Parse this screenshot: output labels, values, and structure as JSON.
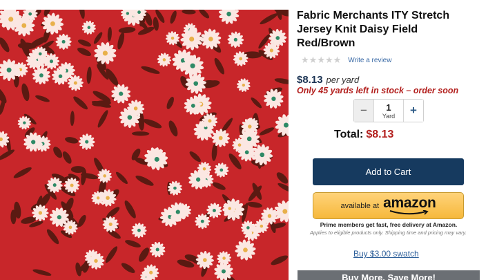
{
  "product": {
    "title_line1": "Fabric Merchants ITY Stretch",
    "title_line2": "Jersey Knit Daisy Field",
    "title_line3": "Red/Brown",
    "rating": 0,
    "rating_max": 5,
    "write_review": "Write a review",
    "price": "$8.13",
    "price_unit": "per yard",
    "stock_message": "Only 45 yards left in stock – order soon",
    "image_icon": "daisy-print-fabric"
  },
  "quantity": {
    "minus": "−",
    "value": "1",
    "unit": "Yard",
    "plus": "+"
  },
  "total": {
    "label": "Total:",
    "amount": "$8.13"
  },
  "buttons": {
    "add_to_cart": "Add to Cart",
    "amazon_available": "available at",
    "amazon_word": "amazon",
    "swatch": "Buy $3.00 swatch",
    "buy_more": "Buy More, Save More!"
  },
  "prime": {
    "headline": "Prime members get fast, free delivery at Amazon.",
    "note": "Applies to eligible products only. Shipping time and pricing may vary."
  },
  "colors": {
    "fabric_red": "#c8262a",
    "petal": "#fbe7e2",
    "leaf_brown": "#5a1a12",
    "leaf_green": "#2e8a66",
    "price_navy": "#1b3353",
    "alert_red": "#b3201e",
    "cart_navy": "#163a5f",
    "amazon_yellow": "#f6b83b",
    "link_blue": "#2d5f9a"
  }
}
